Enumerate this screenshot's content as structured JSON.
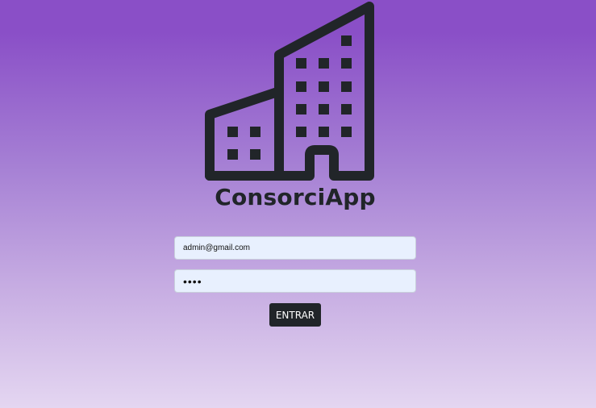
{
  "app": {
    "title": "ConsorciApp",
    "logo_icon": "building-icon"
  },
  "login": {
    "email_value": "admin@gmail.com",
    "password_value": "••••",
    "submit_label": "ENTRAR"
  },
  "colors": {
    "background_top": "#8a4fc7",
    "background_bottom": "#e4d6f1",
    "icon": "#212529",
    "input_bg": "#e8f0fe",
    "button_bg": "#212529"
  }
}
